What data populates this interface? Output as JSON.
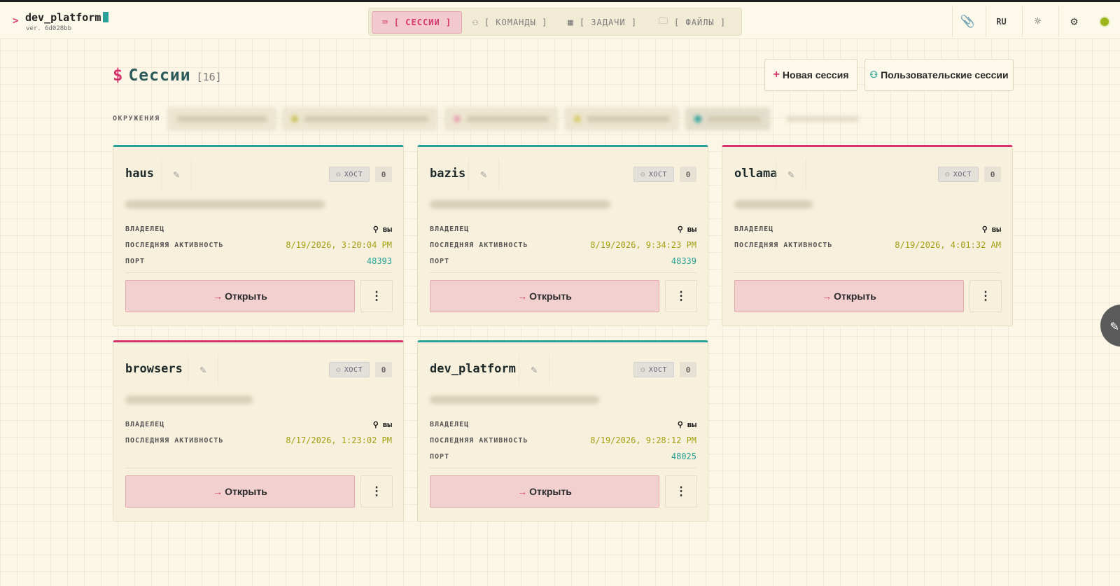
{
  "app": {
    "name": "dev_platform",
    "version": "ver. 6d028bb",
    "prompt": ">"
  },
  "nav": [
    {
      "label": "[ СЕССИИ ]",
      "icon": "terminal-icon",
      "glyph": "⌨"
    },
    {
      "label": "[ КОМАНДЫ ]",
      "icon": "users-icon",
      "glyph": "⚇"
    },
    {
      "label": "[ ЗАДАЧИ ]",
      "icon": "grid-icon",
      "glyph": "▦"
    },
    {
      "label": "[ ФАЙЛЫ ]",
      "icon": "folder-icon",
      "glyph": "🗀"
    }
  ],
  "toolbar": {
    "attach_glyph": "📎",
    "lang": "RU",
    "theme_glyph": "☼",
    "settings_glyph": "⚙"
  },
  "page": {
    "dollar": "$",
    "title": "Сессии",
    "count": "[16]"
  },
  "actions": {
    "new_session": "Новая сессия",
    "new_session_glyph": "+",
    "user_sessions": "Пользовательские сессии",
    "user_glyph": "⚇"
  },
  "environments": {
    "label": "ОКРУЖЕНИЯ"
  },
  "labels": {
    "host": "ХОСТ",
    "owner": "ВЛАДЕЛЕЦ",
    "last_activity": "ПОСЛЕДНЯЯ АКТИВНОСТЬ",
    "port": "ПОРТ",
    "open": "Открыть",
    "open_arrow": "→",
    "edit_glyph": "✎",
    "more_glyph": "⋮",
    "host_glyph": "⚇",
    "owner_glyph": "⚲"
  },
  "sessions": [
    {
      "name": "haus",
      "accent": "#2aa198",
      "count": "0",
      "owner": "вы",
      "last_activity": "8/19/2026, 3:20:04 PM",
      "port": "48393"
    },
    {
      "name": "bazis",
      "accent": "#2aa198",
      "count": "0",
      "owner": "вы",
      "last_activity": "8/19/2026, 9:34:23 PM",
      "port": "48339"
    },
    {
      "name": "ollama",
      "accent": "#d6336c",
      "count": "0",
      "owner": "вы",
      "last_activity": "8/19/2026, 4:01:32 AM",
      "port": ""
    },
    {
      "name": "browsers",
      "accent": "#d6336c",
      "count": "0",
      "owner": "вы",
      "last_activity": "8/17/2026, 1:23:02 PM",
      "port": ""
    },
    {
      "name": "dev_platform",
      "accent": "#2aa198",
      "count": "0",
      "owner": "вы",
      "last_activity": "8/19/2026, 9:28:12 PM",
      "port": "48025"
    }
  ],
  "colors": {
    "accent_pink": "#d6336c",
    "accent_teal": "#2aa198",
    "time": "#a3a015",
    "status": "#9bb51a"
  }
}
